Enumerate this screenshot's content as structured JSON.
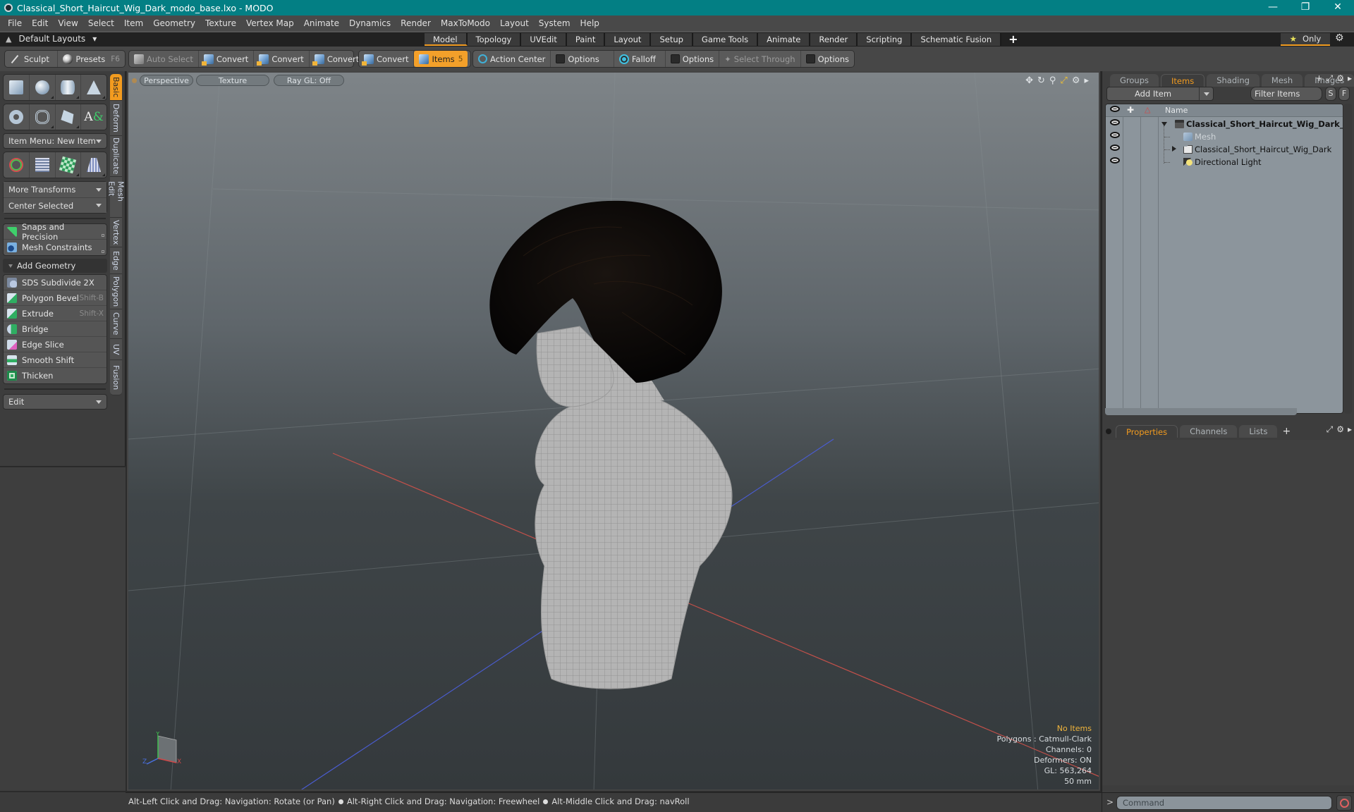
{
  "window": {
    "title": "Classical_Short_Haircut_Wig_Dark_modo_base.lxo - MODO",
    "controls": [
      "minimize",
      "restore",
      "close"
    ]
  },
  "menubar": [
    "File",
    "Edit",
    "View",
    "Select",
    "Item",
    "Geometry",
    "Texture",
    "Vertex Map",
    "Animate",
    "Dynamics",
    "Render",
    "MaxToModo",
    "Layout",
    "System",
    "Help"
  ],
  "layoutbar": {
    "layouts_label": "Default Layouts",
    "tabs": [
      "Model",
      "Topology",
      "UVEdit",
      "Paint",
      "Layout",
      "Setup",
      "Game Tools",
      "Animate",
      "Render",
      "Scripting",
      "Schematic Fusion"
    ],
    "active_tab": "Model",
    "only_label": "Only"
  },
  "toolbar": {
    "sculpt": "Sculpt",
    "presets": "Presets",
    "presets_key": "F6",
    "auto_select": "Auto Select",
    "convert1": "Convert",
    "convert2": "Convert",
    "convert3": "Convert",
    "convert4": "Convert",
    "items": "Items",
    "items_key": "5",
    "action_center": "Action Center",
    "options1": "Options",
    "falloff": "Falloff",
    "options2": "Options",
    "select_through": "Select Through",
    "options3": "Options"
  },
  "leftpanel": {
    "item_menu": "Item Menu: New Item",
    "more_transforms": "More Transforms",
    "center_selected": "Center Selected",
    "snaps": "Snaps and Precision",
    "mesh_constraints": "Mesh Constraints",
    "add_geometry": "Add Geometry",
    "tools": [
      {
        "label": "SDS Subdivide 2X",
        "shortcut": ""
      },
      {
        "label": "Polygon Bevel",
        "shortcut": "Shift-B"
      },
      {
        "label": "Extrude",
        "shortcut": "Shift-X"
      },
      {
        "label": "Bridge",
        "shortcut": ""
      },
      {
        "label": "Edge Slice",
        "shortcut": ""
      },
      {
        "label": "Smooth Shift",
        "shortcut": ""
      },
      {
        "label": "Thicken",
        "shortcut": ""
      }
    ],
    "edit_dropdown": "Edit",
    "vtabs": [
      "Basic",
      "Deform",
      "Duplicate",
      "Mesh Edit",
      "Vertex",
      "Edge",
      "Polygon",
      "Curve",
      "UV",
      "Fusion"
    ],
    "active_vtab": "Basic"
  },
  "viewport": {
    "view_mode": "Perspective",
    "shading": "Texture",
    "raygl": "Ray GL: Off",
    "info": {
      "selection": "No Items",
      "polygons": "Polygons : Catmull-Clark",
      "channels": "Channels: 0",
      "deformers": "Deformers: ON",
      "gl": "GL: 563,264",
      "focal": "50 mm"
    },
    "axis_labels": {
      "x": "X",
      "y": "Y",
      "z": "Z"
    }
  },
  "rightpanel": {
    "top_tabs": [
      "Groups",
      "Items",
      "Shading",
      "Mesh ...",
      "Images"
    ],
    "active_top_tab": "Items",
    "add_item": "Add Item",
    "filter_items": "Filter Items",
    "s_btn": "S",
    "f_btn": "F",
    "tree_header": "Name",
    "tree": [
      {
        "label": "Classical_Short_Haircut_Wig_Dark_ ...",
        "type": "scene",
        "expanded": true
      },
      {
        "label": "Mesh",
        "type": "mesh",
        "dim": true
      },
      {
        "label": "Classical_Short_Haircut_Wig_Dark",
        "type": "group",
        "expanded": false
      },
      {
        "label": "Directional Light",
        "type": "light"
      }
    ],
    "bottom_tabs": [
      "Properties",
      "Channels",
      "Lists"
    ],
    "active_bottom_tab": "Properties",
    "command_placeholder": "Command"
  },
  "statusbar": {
    "hints": [
      "Alt-Left Click and Drag: Navigation: Rotate (or Pan)",
      "Alt-Right Click and Drag: Navigation: Freewheel",
      "Alt-Middle Click and Drag: navRoll"
    ]
  },
  "colors": {
    "titlebar": "#037f84",
    "accent": "#f29b1f",
    "info_warn": "#f0b53c"
  }
}
